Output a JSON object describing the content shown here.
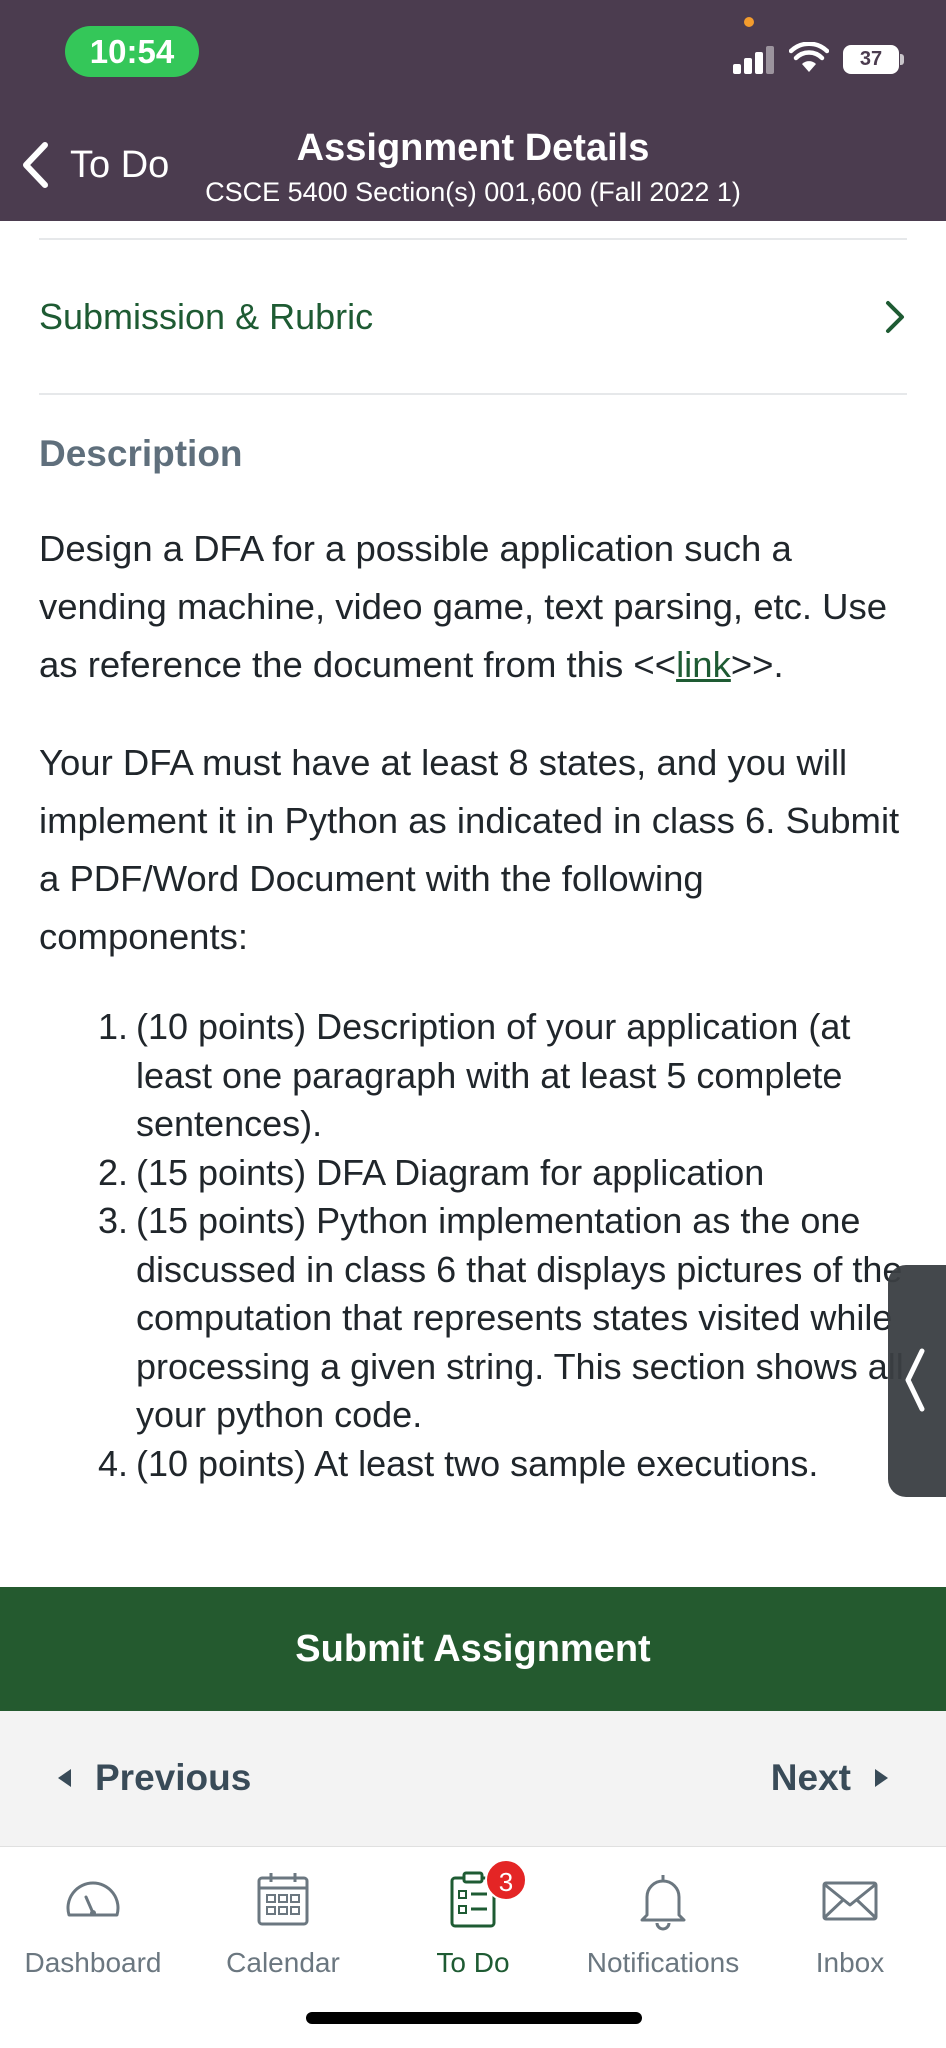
{
  "status_bar": {
    "time": "10:54",
    "battery": "37"
  },
  "nav": {
    "back_label": "To Do",
    "title": "Assignment Details",
    "subtitle": "CSCE 5400 Section(s) 001,600 (Fall 2022 1)"
  },
  "submission": {
    "label": "Submission & Rubric"
  },
  "description": {
    "heading": "Description",
    "p1_text": "Design a DFA for a possible application such a vending machine, video game, text parsing, etc. Use as reference the document from this <<",
    "p1_link": "link",
    "p1_end": ">>.",
    "p2": "Your DFA must have at least 8 states,  and you will implement it in Python as indicated in class 6. Submit a PDF/Word Document with the following components:",
    "items": [
      {
        "num": "1.",
        "text": "(10 points) Description of your application (at least one paragraph with at least 5 complete sentences)."
      },
      {
        "num": "2.",
        "text": "(15 points) DFA Diagram for application"
      },
      {
        "num": "3.",
        "text": "(15 points) Python implementation as the one discussed in class 6 that displays pictures of the computation that represents states visited while processing a given string. This section shows all your python code."
      },
      {
        "num": "4.",
        "text": "(10 points) At least two sample executions."
      }
    ]
  },
  "actions": {
    "submit_label": "Submit Assignment",
    "previous_label": "Previous",
    "next_label": "Next"
  },
  "tabs": [
    {
      "label": "Dashboard",
      "icon": "dashboard-icon"
    },
    {
      "label": "Calendar",
      "icon": "calendar-icon"
    },
    {
      "label": "To Do",
      "icon": "todo-icon",
      "badge": "3"
    },
    {
      "label": "Notifications",
      "icon": "bell-icon"
    },
    {
      "label": "Inbox",
      "icon": "mail-icon"
    }
  ],
  "colors": {
    "header": "#4b3c4f",
    "accent": "#245a2f",
    "link": "#1e5b33",
    "badge": "#e42525"
  }
}
